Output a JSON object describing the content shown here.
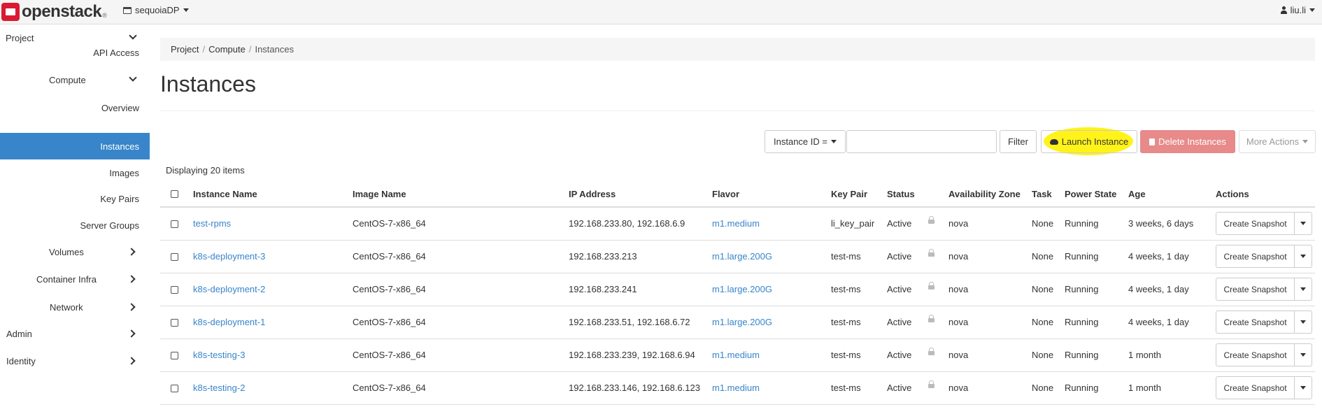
{
  "topbar": {
    "brand": "openstack",
    "brand_tm": "®",
    "project": "sequoiaDP",
    "user": "liu.li"
  },
  "sidebar": {
    "items": [
      {
        "label": "Project",
        "chevron": "down"
      },
      {
        "label": "API Access"
      },
      {
        "label": "Compute",
        "chevron": "down"
      },
      {
        "label": "Overview"
      },
      {
        "label": "Instances",
        "active": true
      },
      {
        "label": "Images"
      },
      {
        "label": "Key Pairs"
      },
      {
        "label": "Server Groups"
      },
      {
        "label": "Volumes",
        "chevron": "right"
      },
      {
        "label": "Container Infra",
        "chevron": "right"
      },
      {
        "label": "Network",
        "chevron": "right"
      },
      {
        "label": "Admin",
        "chevron": "right"
      },
      {
        "label": "Identity",
        "chevron": "right"
      }
    ]
  },
  "breadcrumb": [
    "Project",
    "Compute",
    "Instances"
  ],
  "breadcrumb_sep": "/",
  "page_title": "Instances",
  "toolbar": {
    "filter_select": "Instance ID =",
    "filter_value": "",
    "filter_button": "Filter",
    "launch_button": "Launch Instance",
    "delete_button": "Delete Instances",
    "more_button": "More Actions"
  },
  "count_text": "Displaying 20 items",
  "table": {
    "headers": [
      "Instance Name",
      "Image Name",
      "IP Address",
      "Flavor",
      "Key Pair",
      "Status",
      "Availability Zone",
      "Task",
      "Power State",
      "Age",
      "Actions"
    ],
    "rows": [
      {
        "name": "test-rpms",
        "image": "CentOS-7-x86_64",
        "ip": "192.168.233.80, 192.168.6.9",
        "flavor": "m1.medium",
        "keypair": "li_key_pair",
        "status": "Active",
        "zone": "nova",
        "task": "None",
        "power": "Running",
        "age": "3 weeks, 6 days",
        "action": "Create Snapshot"
      },
      {
        "name": "k8s-deployment-3",
        "image": "CentOS-7-x86_64",
        "ip": "192.168.233.213",
        "flavor": "m1.large.200G",
        "keypair": "test-ms",
        "status": "Active",
        "zone": "nova",
        "task": "None",
        "power": "Running",
        "age": "4 weeks, 1 day",
        "action": "Create Snapshot"
      },
      {
        "name": "k8s-deployment-2",
        "image": "CentOS-7-x86_64",
        "ip": "192.168.233.241",
        "flavor": "m1.large.200G",
        "keypair": "test-ms",
        "status": "Active",
        "zone": "nova",
        "task": "None",
        "power": "Running",
        "age": "4 weeks, 1 day",
        "action": "Create Snapshot"
      },
      {
        "name": "k8s-deployment-1",
        "image": "CentOS-7-x86_64",
        "ip": "192.168.233.51, 192.168.6.72",
        "flavor": "m1.large.200G",
        "keypair": "test-ms",
        "status": "Active",
        "zone": "nova",
        "task": "None",
        "power": "Running",
        "age": "4 weeks, 1 day",
        "action": "Create Snapshot"
      },
      {
        "name": "k8s-testing-3",
        "image": "CentOS-7-x86_64",
        "ip": "192.168.233.239, 192.168.6.94",
        "flavor": "m1.medium",
        "keypair": "test-ms",
        "status": "Active",
        "zone": "nova",
        "task": "None",
        "power": "Running",
        "age": "1 month",
        "action": "Create Snapshot"
      },
      {
        "name": "k8s-testing-2",
        "image": "CentOS-7-x86_64",
        "ip": "192.168.233.146, 192.168.6.123",
        "flavor": "m1.medium",
        "keypair": "test-ms",
        "status": "Active",
        "zone": "nova",
        "task": "None",
        "power": "Running",
        "age": "1 month",
        "action": "Create Snapshot"
      }
    ]
  },
  "colors": {
    "accent": "#3885c9",
    "danger": "#e88a8a",
    "highlight": "#fff200"
  }
}
